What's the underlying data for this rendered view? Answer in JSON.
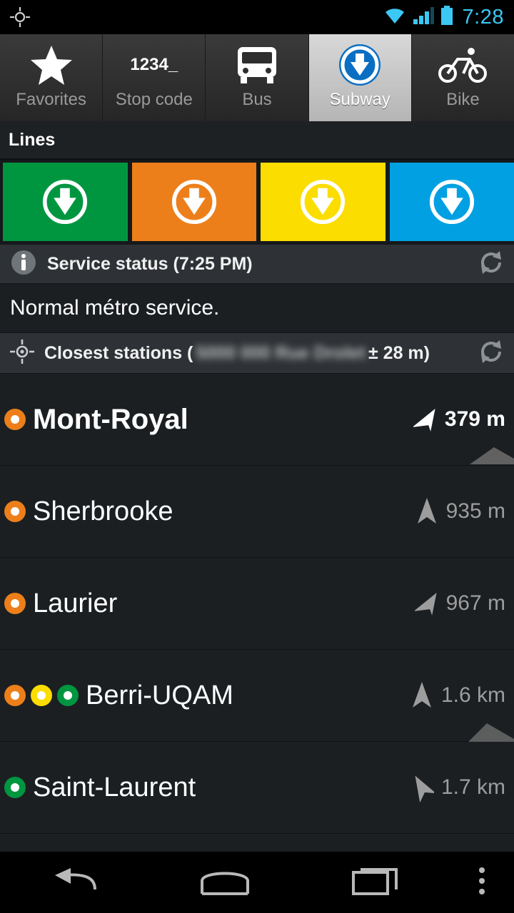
{
  "statusbar": {
    "time": "7:28",
    "icons": [
      "gps-fix-icon",
      "wifi-icon",
      "cellular-signal-icon",
      "battery-icon"
    ]
  },
  "tabs": [
    {
      "label": "Favorites",
      "icon": "star-icon",
      "active": false
    },
    {
      "label": "Stop code",
      "icon": "keypad-1234-icon",
      "active": false,
      "icon_text": "1234_"
    },
    {
      "label": "Bus",
      "icon": "bus-icon",
      "active": false
    },
    {
      "label": "Subway",
      "icon": "subway-metro-icon",
      "active": true
    },
    {
      "label": "Bike",
      "icon": "bike-icon",
      "active": false
    }
  ],
  "lines_section": {
    "header": "Lines",
    "lines": [
      {
        "name": "green-line",
        "color": "#009640"
      },
      {
        "name": "orange-line",
        "color": "#ed7f1a"
      },
      {
        "name": "yellow-line",
        "color": "#fbdd00"
      },
      {
        "name": "blue-line",
        "color": "#00a0e2"
      }
    ]
  },
  "service_status": {
    "title": "Service status (7:25 PM)",
    "message": "Normal métro service.",
    "info_icon": "info-icon",
    "refresh_icon": "refresh-icon"
  },
  "closest": {
    "title_prefix": "Closest stations (",
    "address_blurred": "5000  000 Rue Drolet",
    "title_suffix": "± 28 m)",
    "gps_icon": "gps-fix-icon",
    "refresh_icon": "refresh-icon"
  },
  "stations": [
    {
      "name": "Mont-Royal",
      "distance": "379 m",
      "highlight": true,
      "arrow": "direction-arrow-up-right",
      "lines": [
        "#ed7f1a"
      ],
      "edge_marker": true
    },
    {
      "name": "Sherbrooke",
      "distance": "935 m",
      "highlight": false,
      "arrow": "direction-arrow-up",
      "lines": [
        "#ed7f1a"
      ],
      "edge_marker": false
    },
    {
      "name": "Laurier",
      "distance": "967 m",
      "highlight": false,
      "arrow": "direction-arrow-up-right",
      "lines": [
        "#ed7f1a"
      ],
      "edge_marker": false
    },
    {
      "name": "Berri-UQAM",
      "distance": "1.6 km",
      "highlight": false,
      "arrow": "direction-arrow-up",
      "lines": [
        "#ed7f1a",
        "#fbdd00",
        "#009640"
      ],
      "edge_marker": true
    },
    {
      "name": "Saint-Laurent",
      "distance": "1.7 km",
      "highlight": false,
      "arrow": "direction-arrow-up-left",
      "lines": [
        "#009640"
      ],
      "edge_marker": false
    }
  ],
  "navbar": {
    "buttons": [
      {
        "name": "back-button",
        "icon": "back-arrow-icon"
      },
      {
        "name": "home-button",
        "icon": "home-icon"
      },
      {
        "name": "recents-button",
        "icon": "recents-icon"
      },
      {
        "name": "overflow-menu-button",
        "icon": "overflow-menu-icon"
      }
    ]
  },
  "colors": {
    "accent": "#3bc8f5",
    "bg": "#1b1f22",
    "bar": "#2e3236"
  }
}
